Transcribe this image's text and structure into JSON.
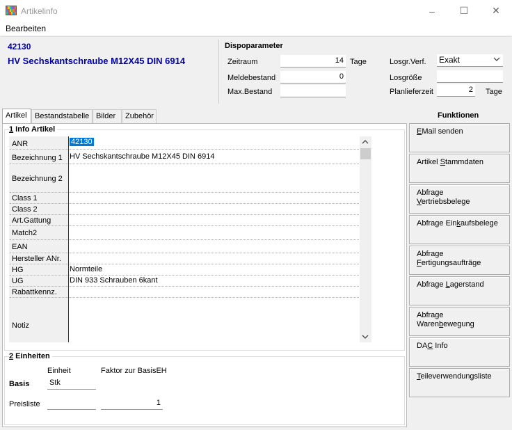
{
  "window": {
    "title": "Artikelinfo",
    "minimize": "–",
    "maximize": "☐",
    "close": "✕"
  },
  "menu": {
    "edit": "Bearbeiten"
  },
  "article": {
    "anr": "42130",
    "description": "HV Sechskantschraube M12X45 DIN 6914"
  },
  "dispo": {
    "title": "Dispoparameter",
    "zeitraum_label": "Zeitraum",
    "zeitraum_value": "14",
    "zeitraum_unit": "Tage",
    "meldebestand_label": "Meldebestand",
    "meldebestand_value": "0",
    "maxbestand_label": "Max.Bestand",
    "maxbestand_value": "",
    "losgr_verf_label": "Losgr.Verf.",
    "losgr_verf_value": "Exakt",
    "losgroesse_label": "Losgröße",
    "losgroesse_value": "",
    "planlieferzeit_label": "Planlieferzeit",
    "planlieferzeit_value": "2",
    "planlieferzeit_unit": "Tage"
  },
  "tabs": [
    "Artikel",
    "Bestandstabelle",
    "Bilder",
    "Zubehör"
  ],
  "info": {
    "group_num": "1",
    "group_title": " Info Artikel",
    "rows": [
      {
        "label": "ANR",
        "value": "42130"
      },
      {
        "label": "Bezeichnung 1",
        "value": "HV Sechskantschraube M12X45 DIN 6914"
      },
      {
        "label": "Bezeichnung 2",
        "value": ""
      },
      {
        "label": "Class 1",
        "value": ""
      },
      {
        "label": "Class 2",
        "value": ""
      },
      {
        "label": "Art.Gattung",
        "value": ""
      },
      {
        "label": "Match2",
        "value": ""
      },
      {
        "label": "EAN",
        "value": ""
      },
      {
        "label": "Hersteller ANr.",
        "value": ""
      },
      {
        "label": "HG",
        "value": "Normteile"
      },
      {
        "label": "UG",
        "value": "DIN 933 Schrauben 6kant"
      },
      {
        "label": "Rabattkennz.",
        "value": ""
      },
      {
        "label": "Notiz",
        "value": ""
      }
    ]
  },
  "units": {
    "group_num": "2",
    "group_title": " Einheiten",
    "col_unit": "Einheit",
    "col_factor": "Faktor zur BasisEH",
    "basis_label": "Basis",
    "basis_unit": "Stk",
    "pricelist_label": "Preisliste",
    "pricelist_unit": "",
    "pricelist_factor": "1"
  },
  "functions": {
    "title": "Funktionen",
    "buttons": [
      {
        "pre": "",
        "ul": "E",
        "post": "Mail senden"
      },
      {
        "pre": "Artikel ",
        "ul": "S",
        "post": "tammdaten"
      },
      {
        "pre": "Abfrage\n",
        "ul": "V",
        "post": "ertriebsbelege"
      },
      {
        "pre": "Abfrage Ein",
        "ul": "k",
        "post": "aufsbelege"
      },
      {
        "pre": "Abfrage\n",
        "ul": "F",
        "post": "ertigungsaufträge"
      },
      {
        "pre": "Abfrage ",
        "ul": "L",
        "post": "agerstand"
      },
      {
        "pre": "Abfrage\nWaren",
        "ul": "b",
        "post": "ewegung"
      },
      {
        "pre": "DA",
        "ul": "C",
        "post": " Info"
      },
      {
        "pre": "",
        "ul": "T",
        "post": "eileverwendungsliste"
      }
    ]
  },
  "colors": {
    "accent_blue": "#0000aa",
    "selection": "#0078d7"
  }
}
